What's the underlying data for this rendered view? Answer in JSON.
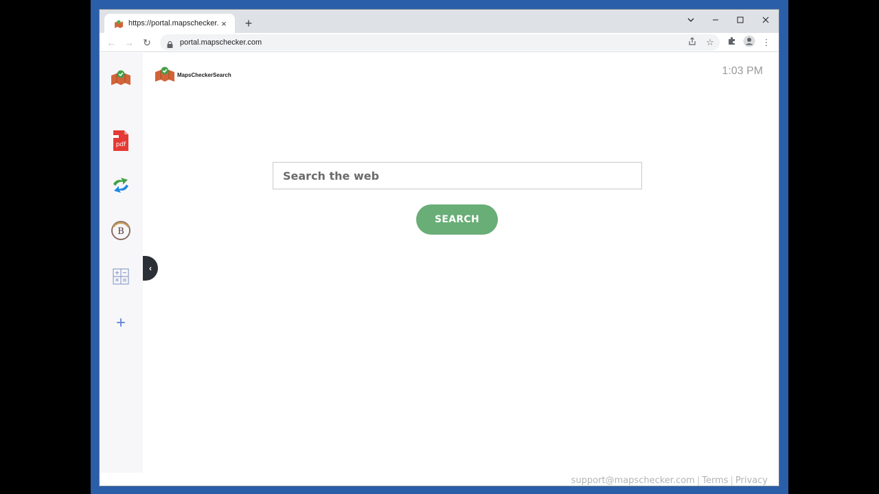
{
  "browser": {
    "tab_title": "https://portal.mapschecker.com",
    "tab_close": "×",
    "new_tab": "+",
    "url": "portal.mapschecker.com",
    "window_controls": {
      "dropdown": "⌄",
      "minimize": "—",
      "maximize": "□",
      "close": "✕"
    },
    "nav": {
      "back": "←",
      "forward": "→",
      "reload": "↻"
    },
    "omni_icons": {
      "share": "⇪",
      "bookmark": "☆",
      "extensions": "✦",
      "menu": "⋮"
    }
  },
  "brand": {
    "name": "MapsCheckerSearch"
  },
  "clock": "1:03 PM",
  "search": {
    "placeholder": "Search the web",
    "button_label": "SEARCH"
  },
  "sidebar": {
    "items": [
      {
        "name": "mapschecker-logo-icon"
      },
      {
        "name": "pdf-icon",
        "label": "pdf"
      },
      {
        "name": "arrows-icon"
      },
      {
        "name": "bitcoin-b-icon",
        "label": "B"
      },
      {
        "name": "calculator-icon"
      },
      {
        "name": "add-icon",
        "label": "+"
      }
    ],
    "collapse": "‹"
  },
  "footer": {
    "support": "support@mapschecker.com",
    "separator": "|",
    "terms": "Terms",
    "privacy": "Privacy"
  },
  "colors": {
    "accent": "#69ad77",
    "desktop": "#2a5ea8",
    "map_orange": "#d2643a",
    "pdf_red": "#e53935"
  }
}
